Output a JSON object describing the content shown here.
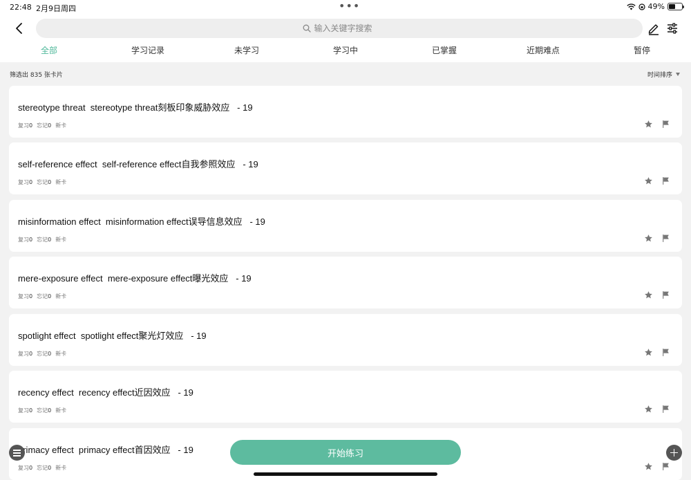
{
  "status_bar": {
    "time": "22:48",
    "date": "2月9日周四",
    "battery": "49%",
    "battery_level": 0.49
  },
  "header": {
    "search_placeholder": "输入关键字搜索"
  },
  "tabs": [
    {
      "label": "全部",
      "active": true
    },
    {
      "label": "学习记录",
      "active": false
    },
    {
      "label": "未学习",
      "active": false
    },
    {
      "label": "学习中",
      "active": false
    },
    {
      "label": "已掌握",
      "active": false
    },
    {
      "label": "近期难点",
      "active": false
    },
    {
      "label": "暂停",
      "active": false
    }
  ],
  "toolbar": {
    "filter_count": "筛选出 835 张卡片",
    "sort_label": "时间排序"
  },
  "cards": [
    {
      "title": "stereotype threat  stereotype threat刻板印象威胁效应   - 19",
      "review_label": "复习",
      "review_count": "0",
      "forget_label": "忘记",
      "forget_count": "0",
      "status": "新卡"
    },
    {
      "title": "self-reference effect  self-reference effect自我参照效应   - 19",
      "review_label": "复习",
      "review_count": "0",
      "forget_label": "忘记",
      "forget_count": "0",
      "status": "新卡"
    },
    {
      "title": "misinformation effect  misinformation effect误导信息效应   - 19",
      "review_label": "复习",
      "review_count": "0",
      "forget_label": "忘记",
      "forget_count": "0",
      "status": "新卡"
    },
    {
      "title": "mere-exposure effect  mere-exposure effect曝光效应   - 19",
      "review_label": "复习",
      "review_count": "0",
      "forget_label": "忘记",
      "forget_count": "0",
      "status": "新卡"
    },
    {
      "title": "spotlight effect  spotlight effect聚光灯效应   - 19",
      "review_label": "复习",
      "review_count": "0",
      "forget_label": "忘记",
      "forget_count": "0",
      "status": "新卡"
    },
    {
      "title": "recency effect  recency effect近因效应   - 19",
      "review_label": "复习",
      "review_count": "0",
      "forget_label": "忘记",
      "forget_count": "0",
      "status": "新卡"
    },
    {
      "title": "primacy effect  primacy effect首因效应   - 19",
      "review_label": "复习",
      "review_count": "0",
      "forget_label": "忘记",
      "forget_count": "0",
      "status": "新卡"
    }
  ],
  "bottom": {
    "start_label": "开始练习"
  },
  "colors": {
    "accent": "#4fb89a",
    "start_button": "#5dbb9f",
    "background": "#f2f2f2",
    "card": "#ffffff"
  },
  "icons": [
    "back-chevron-icon",
    "search-icon",
    "edit-pen-icon",
    "filter-sliders-icon",
    "sort-arrow-icon",
    "star-icon",
    "flag-icon",
    "menu-icon",
    "plus-icon",
    "wifi-icon",
    "lock-rotation-icon",
    "battery-icon"
  ]
}
